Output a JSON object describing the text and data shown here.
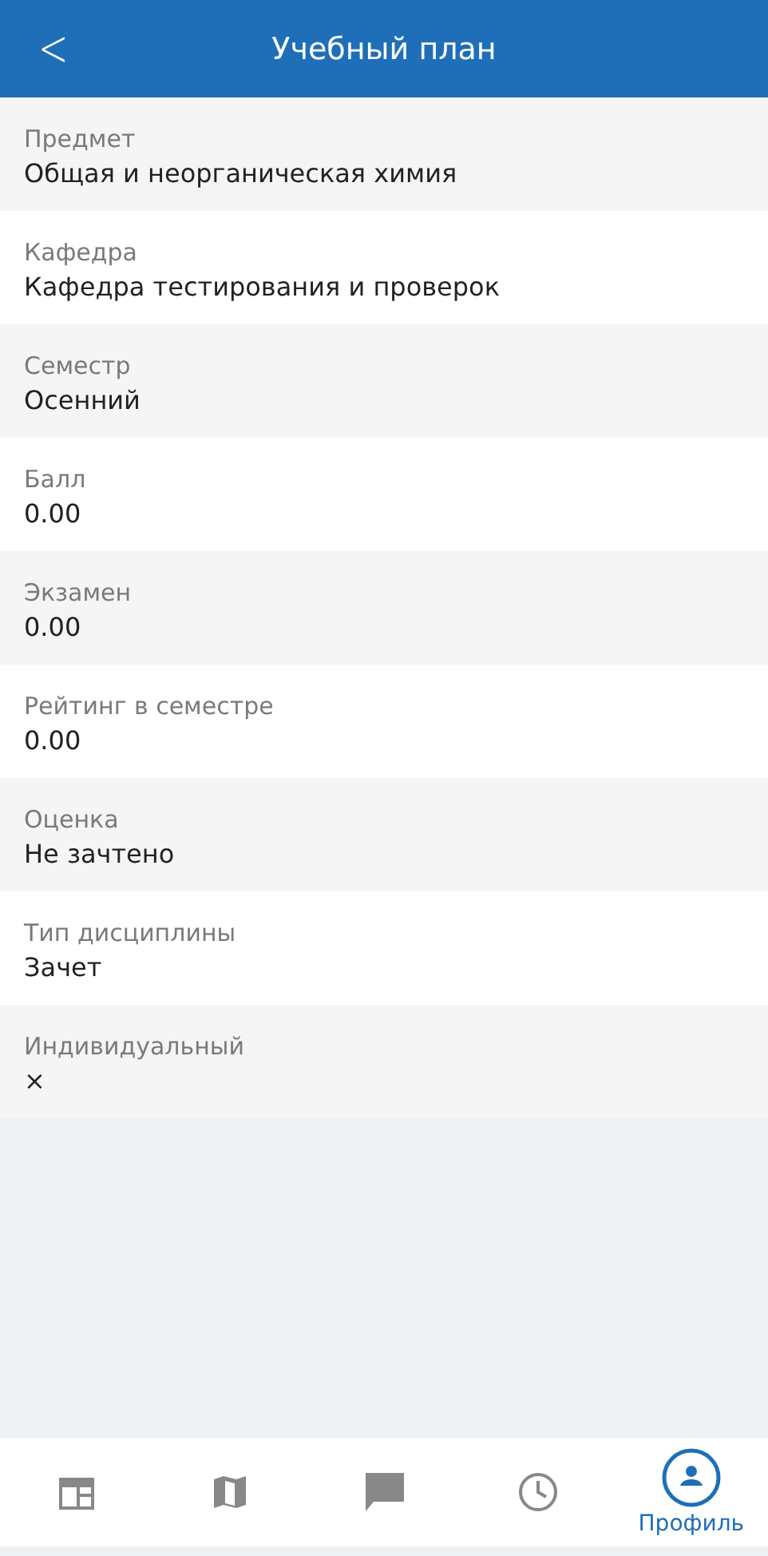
{
  "header": {
    "back": "<",
    "title": "Учебный план"
  },
  "fields": [
    {
      "label": "Предмет",
      "value": "Общая и неорганическая химия"
    },
    {
      "label": "Кафедра",
      "value": "Кафедра тестирования и проверок"
    },
    {
      "label": "Семестр",
      "value": "Осенний"
    },
    {
      "label": "Балл",
      "value": "0.00"
    },
    {
      "label": "Экзамен",
      "value": "0.00"
    },
    {
      "label": "Рейтинг в семестре",
      "value": "0.00"
    },
    {
      "label": "Оценка",
      "value": "Не зачтено"
    },
    {
      "label": "Тип дисциплины",
      "value": "Зачет"
    },
    {
      "label": "Индивидуальный",
      "value": "×"
    }
  ],
  "tab_bar": [
    {
      "kind": "calendar",
      "selected": false
    },
    {
      "kind": "map",
      "selected": false
    },
    {
      "kind": "chat",
      "selected": false
    },
    {
      "kind": "clock",
      "selected": false
    },
    {
      "kind": "profile",
      "selected": true,
      "label": "Профиль"
    }
  ]
}
